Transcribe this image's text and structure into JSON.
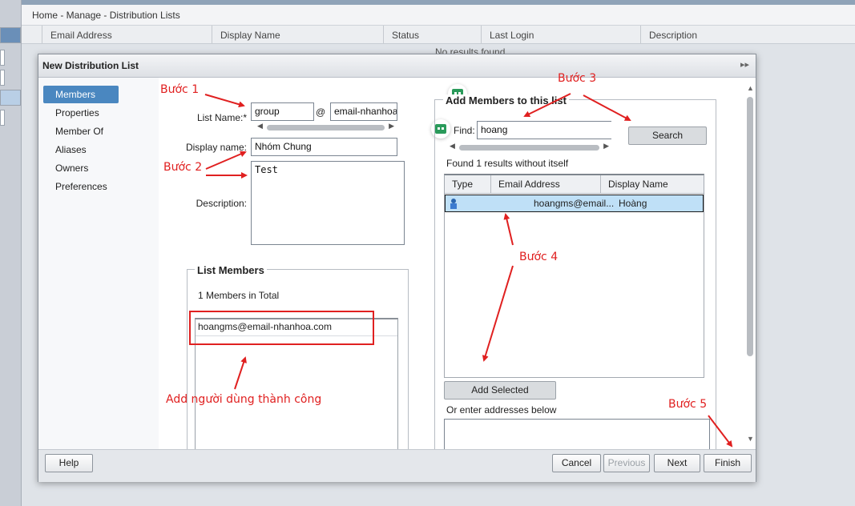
{
  "breadcrumb": "Home - Manage - Distribution Lists",
  "list_columns": [
    "Email Address",
    "Display Name",
    "Status",
    "Last Login",
    "Description"
  ],
  "no_results": "No results found",
  "dialog": {
    "title": "New Distribution List",
    "nav": [
      "Members",
      "Properties",
      "Member Of",
      "Aliases",
      "Owners",
      "Preferences"
    ],
    "form": {
      "list_name_label": "List Name:*",
      "list_name_value": "group",
      "at": "@",
      "domain_value": "email-nhanhoa",
      "display_name_label": "Display name:",
      "display_name_value": "Nhóm Chung",
      "description_label": "Description:",
      "description_value": "Test"
    },
    "list_members": {
      "title": "List Members",
      "count": "1 Members in Total",
      "items": [
        "hoangms@email-nhanhoa.com"
      ]
    },
    "add_members": {
      "title": "Add Members to this list",
      "find_label": "Find:",
      "find_value": "hoang",
      "search_button": "Search",
      "found_text": "Found 1 results without itself",
      "columns": [
        "Type",
        "Email Address",
        "Display Name"
      ],
      "rows": [
        {
          "email": "hoangms@email...",
          "name": "Hoàng"
        }
      ],
      "add_selected_button": "Add Selected",
      "enter_addresses_label": "Or enter addresses below"
    },
    "footer": {
      "help": "Help",
      "cancel": "Cancel",
      "previous": "Previous",
      "next": "Next",
      "finish": "Finish"
    }
  },
  "annotations": {
    "step1": "Bước 1",
    "step2": "Bước 2",
    "step3": "Bước 3",
    "step4": "Bước 4",
    "step5": "Bước 5",
    "success": "Add người dùng thành công",
    "color": "#e02020"
  }
}
